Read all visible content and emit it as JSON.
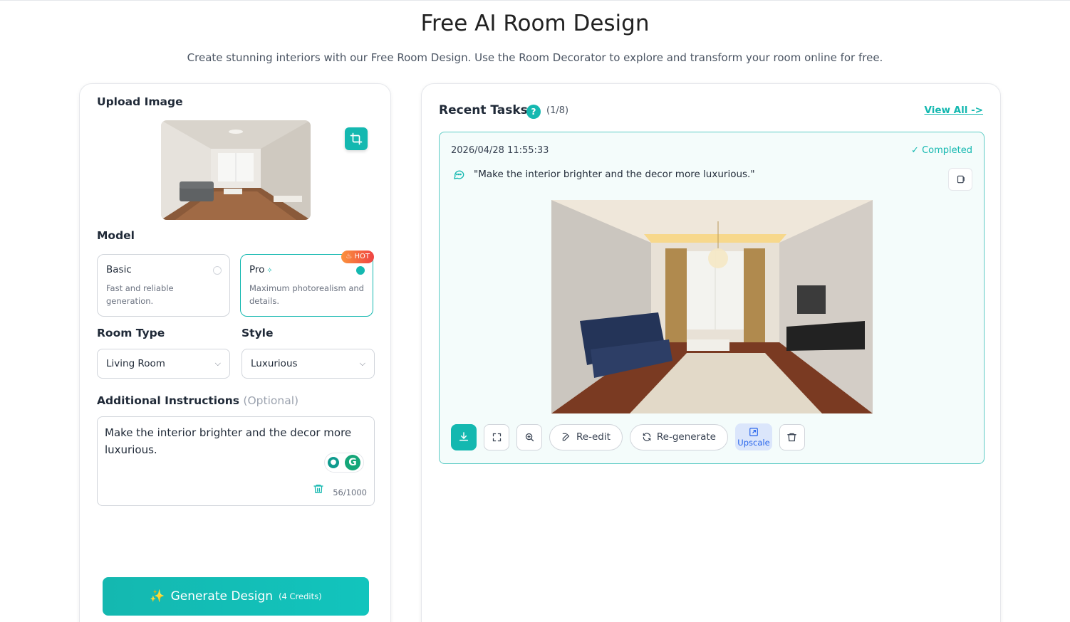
{
  "header": {
    "title": "Free AI Room Design",
    "subtitle": "Create stunning interiors with our Free Room Design. Use the Room Decorator to explore and transform your room online for free."
  },
  "left_panel": {
    "upload_label": "Upload Image",
    "model_label": "Model",
    "models": [
      {
        "name": "Basic",
        "description": "Fast and reliable generation.",
        "selected": false
      },
      {
        "name": "Pro",
        "description": "Maximum photorealism and details.",
        "selected": true,
        "badge": "HOT"
      }
    ],
    "room_type_label": "Room Type",
    "room_type_value": "Living Room",
    "style_label": "Style",
    "style_value": "Luxurious",
    "instructions_label": "Additional Instructions",
    "instructions_optional": "(Optional)",
    "instructions_value": "Make the interior brighter and the decor more luxurious.",
    "char_count": "56/1000",
    "generate_label": "Generate Design",
    "generate_credits": "(4 Credits)"
  },
  "right_panel": {
    "title": "Recent Tasks",
    "help_glyph": "?",
    "task_count": "(1/8)",
    "view_all": "View All ->",
    "task": {
      "timestamp": "2026/04/28 11:55:33",
      "status": "Completed",
      "prompt": "\"Make the interior brighter and the decor more luxurious.\""
    },
    "actions": {
      "reedit": "Re-edit",
      "regenerate": "Re-generate",
      "upscale": "Upscale"
    }
  },
  "colors": {
    "accent": "#14b8b0",
    "upscale_bg": "#dbe6fb",
    "hot_badge": "#ef4444"
  }
}
